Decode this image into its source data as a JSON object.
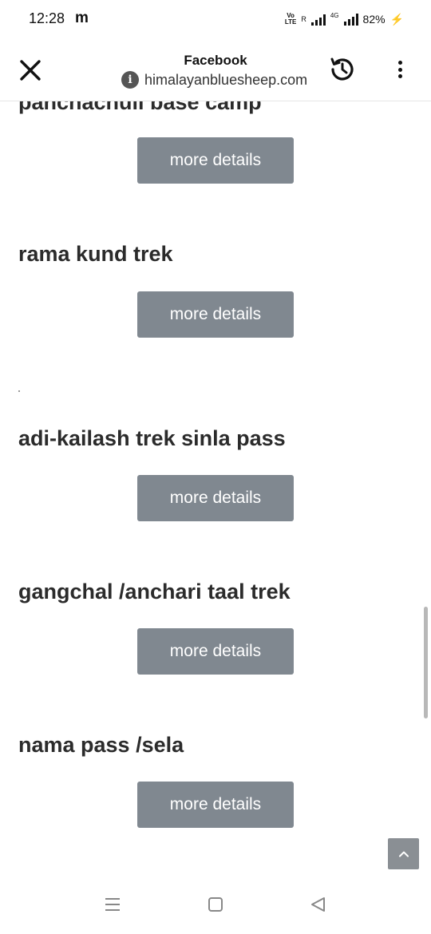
{
  "status_bar": {
    "time": "12:28",
    "notification_letter": "m",
    "volte_line1": "Vo",
    "volte_line2": "LTE",
    "roaming": "R",
    "network": "4G",
    "battery": "82%"
  },
  "browser": {
    "title": "Facebook",
    "url": "himalayanbluesheep.com",
    "icons": [
      "close-icon",
      "info-icon",
      "history-icon",
      "more-vertical-icon"
    ]
  },
  "content": {
    "partial_heading": "panchachuli base camp",
    "button_label": "more details",
    "treks": [
      {
        "title": "rama kund trek",
        "button": "more details"
      },
      {
        "title": "adi-kailash trek sinla pass",
        "button": "more details"
      },
      {
        "title": "gangchal /anchari taal trek",
        "button": "more details"
      },
      {
        "title": "nama pass /sela",
        "button": "more details"
      }
    ],
    "first_button": "more details"
  },
  "nav": {
    "icons": [
      "recent-apps-icon",
      "home-icon",
      "back-icon"
    ]
  },
  "colors": {
    "button_bg": "#808890",
    "heading": "#2b2b2b",
    "charging": "#1fb36b"
  }
}
